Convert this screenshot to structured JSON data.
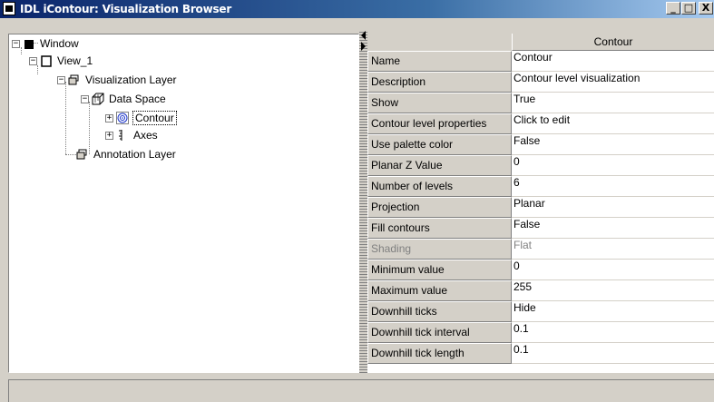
{
  "title": "IDL iContour: Visualization Browser",
  "window_controls": {
    "minimize": "_",
    "maximize": "□",
    "close": "X"
  },
  "tree": {
    "nodes": [
      {
        "label": "Window",
        "icon": "window-icon"
      },
      {
        "label": "View_1",
        "icon": "view-icon"
      },
      {
        "label": "Visualization Layer",
        "icon": "layer-icon"
      },
      {
        "label": "Data Space",
        "icon": "data-space-icon"
      },
      {
        "label": "Contour",
        "icon": "contour-icon",
        "selected": true
      },
      {
        "label": "Axes",
        "icon": "axes-icon"
      },
      {
        "label": "Annotation Layer",
        "icon": "layer-icon"
      }
    ]
  },
  "grid": {
    "column_header": "Contour",
    "rows": [
      {
        "name": "Name",
        "value": "Contour"
      },
      {
        "name": "Description",
        "value": "Contour level visualization"
      },
      {
        "name": "Show",
        "value": "True"
      },
      {
        "name": "Contour level properties",
        "value": "Click to edit"
      },
      {
        "name": "Use palette color",
        "value": "False"
      },
      {
        "name": "Planar Z Value",
        "value": "0"
      },
      {
        "name": "Number of levels",
        "value": "6"
      },
      {
        "name": "Projection",
        "value": "Planar"
      },
      {
        "name": "Fill contours",
        "value": "False"
      },
      {
        "name": "Shading",
        "value": "Flat",
        "disabled": true
      },
      {
        "name": "Minimum value",
        "value": "0"
      },
      {
        "name": "Maximum value",
        "value": "255"
      },
      {
        "name": "Downhill ticks",
        "value": "Hide"
      },
      {
        "name": "Downhill tick interval",
        "value": "0.1"
      },
      {
        "name": "Downhill tick length",
        "value": "0.1"
      }
    ]
  },
  "status_text": ""
}
